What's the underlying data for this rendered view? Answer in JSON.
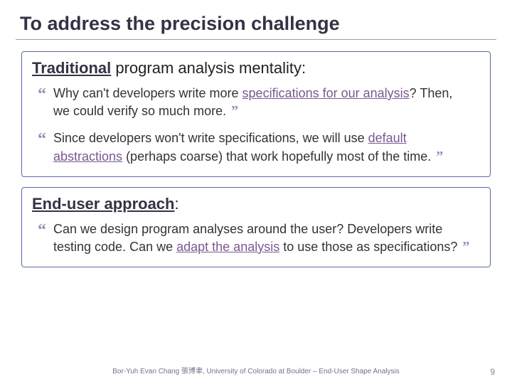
{
  "title": "To address the precision challenge",
  "box1": {
    "heading_underlined": "Traditional",
    "heading_rest": " program analysis mentality:",
    "quotes": [
      {
        "p0": "Why can't developers write more ",
        "e0": "specifications for our analysis",
        "p1": "?  Then, we could verify so much more."
      },
      {
        "p0": "Since developers won't write specifications, we will use ",
        "e0": "default abstractions",
        "p1": " (perhaps coarse) that work hopefully most of the time."
      }
    ]
  },
  "box2": {
    "heading_underlined": "End-user approach",
    "heading_rest": ":",
    "quotes": [
      {
        "p0": "Can we design program analyses around the user? Developers write testing code.  Can we ",
        "e0": "adapt the analysis",
        "p1": " to use those as specifications?"
      }
    ]
  },
  "footer": "Bor-Yuh Evan Chang 張博聿, University of Colorado at Boulder – End-User Shape Analysis",
  "page_number": "9"
}
